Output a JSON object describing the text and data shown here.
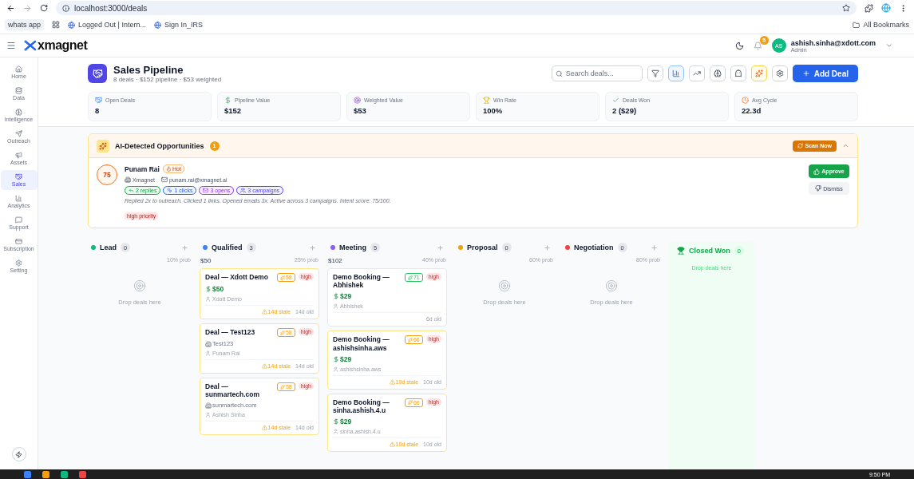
{
  "browser": {
    "url": "localhost:3000/deals",
    "bookmarks": [
      {
        "label": "whats app",
        "kind": "chip"
      },
      {
        "label": "Logged Out | Intern...",
        "kind": "site"
      },
      {
        "label": "Sign In_IRS",
        "kind": "site"
      }
    ],
    "all_bookmarks": "All Bookmarks"
  },
  "header": {
    "logo": "xmagnet",
    "notifications": "5",
    "avatar": "AS",
    "email": "ashish.sinha@xdott.com",
    "role": "Admin"
  },
  "sidebar": {
    "items": [
      {
        "label": "Home",
        "selected": false
      },
      {
        "label": "Data",
        "selected": false
      },
      {
        "label": "Intelligence",
        "selected": false
      },
      {
        "label": "Outreach",
        "selected": false
      },
      {
        "label": "Assets",
        "selected": false
      },
      {
        "label": "Sales",
        "selected": true
      },
      {
        "label": "Analytics",
        "selected": false
      },
      {
        "label": "Support",
        "selected": false
      },
      {
        "label": "Subscription",
        "selected": false
      },
      {
        "label": "Setting",
        "selected": false
      }
    ]
  },
  "page": {
    "title": "Sales Pipeline",
    "subtitle": "8 deals · $152 pipeline · $53 weighted",
    "search": {
      "placeholder": "Search deals..."
    },
    "tools": [
      {
        "selected": false
      },
      {
        "selected": true
      },
      {
        "selected": false
      },
      {
        "selected": false
      },
      {
        "selected": false
      },
      {
        "selected": true
      },
      {
        "selected": false
      }
    ],
    "add_button": "Add Deal"
  },
  "stats": [
    {
      "label": "Open Deals",
      "value": "8"
    },
    {
      "label": "Pipeline Value",
      "value": "$152"
    },
    {
      "label": "Weighted Value",
      "value": "$53"
    },
    {
      "label": "Win Rate",
      "value": "100%"
    },
    {
      "label": "Deals Won",
      "value": "2 ($29)"
    },
    {
      "label": "Avg Cycle",
      "value": "22.3d"
    }
  ],
  "ai_panel": {
    "title": "AI-Detected Opportunities",
    "count": "1",
    "scan_button": "Scan Now",
    "expanded": true,
    "items": [
      {
        "score": "75",
        "name": "Punam Rai",
        "tag": "Hot",
        "company": "Xmagnet",
        "email": "punam.rai@xmagnet.ai",
        "chips": [
          {
            "label": "2 replies",
            "color": "#16a34a"
          },
          {
            "label": "1 clicks",
            "color": "#2563eb"
          },
          {
            "label": "3 opens",
            "color": "#9333ea"
          },
          {
            "label": "3 campaigns",
            "color": "#4f46e5"
          }
        ],
        "summary": "Replied 2x to outreach. Clicked 1 links. Opened emails 3x. Active across 3 campaigns. Intent score: 75/100.",
        "priority": "high priority",
        "approve": "Approve",
        "dismiss": "Dismiss"
      }
    ]
  },
  "columns": [
    {
      "kind": "stage",
      "name": "Lead",
      "color": "#10b981",
      "count": "0",
      "prob": "10% prob",
      "empty": "Drop deals here"
    },
    {
      "kind": "stage",
      "name": "Qualified",
      "color": "#3b82f6",
      "count": "3",
      "total": "$50",
      "prob": "25% prob",
      "deals": [
        {
          "title": "Deal — Xdott Demo",
          "score": "58",
          "color": "#f59e0b",
          "priority": "high",
          "amount": "$50",
          "contact": "Xdott Demo",
          "stale": "14d stale",
          "age": "14d old"
        },
        {
          "title": "Deal — Test123",
          "score": "58",
          "color": "#f59e0b",
          "priority": "high",
          "company": "Test123",
          "contact": "Punam Rai",
          "stale": "14d stale",
          "age": "14d old"
        },
        {
          "title": "Deal — sunmartech.com",
          "score": "58",
          "color": "#f59e0b",
          "priority": "high",
          "company": "sunmartech.com",
          "contact": "Ashish Sinha",
          "stale": "14d stale",
          "age": "14d old"
        }
      ]
    },
    {
      "kind": "stage",
      "name": "Meeting",
      "color": "#8b5cf6",
      "count": "5",
      "total": "$102",
      "prob": "40% prob",
      "deals": [
        {
          "title": "Demo Booking — Abhishek",
          "score": "71",
          "color": "#22c55e",
          "priority": "high",
          "amount": "$29",
          "contact": "Abhishek",
          "age": "6d old"
        },
        {
          "title": "Demo Booking — ashishsinha.aws",
          "score": "66",
          "color": "#f59e0b",
          "priority": "high",
          "amount": "$29",
          "contact": "ashishsinha.aws",
          "stale": "10d stale",
          "age": "10d old"
        },
        {
          "title": "Demo Booking — sinha.ashish.4.u",
          "score": "66",
          "color": "#f59e0b",
          "priority": "high",
          "amount": "$29",
          "contact": "sinha.ashish.4.u",
          "stale": "10d stale",
          "age": "10d old"
        }
      ]
    },
    {
      "kind": "stage",
      "name": "Proposal",
      "color": "#f59e0b",
      "count": "0",
      "prob": "60% prob",
      "empty": "Drop deals here"
    },
    {
      "kind": "stage",
      "name": "Negotiation",
      "color": "#ef4444",
      "count": "0",
      "prob": "80% prob",
      "empty": "Drop deals here"
    },
    {
      "kind": "won",
      "name": "Closed Won",
      "color": "#16a34a",
      "count": "0",
      "empty": "Drop deals here"
    }
  ],
  "taskbar": {
    "time": "9:50 PM"
  }
}
